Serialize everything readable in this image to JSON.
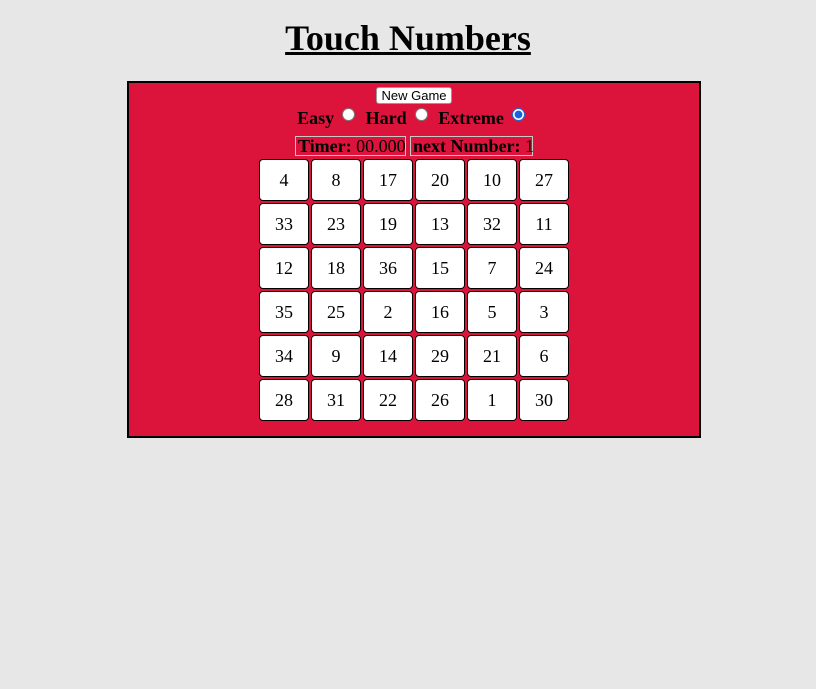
{
  "header": {
    "title": "Touch Numbers"
  },
  "controls": {
    "new_game_label": "New Game",
    "difficulties": [
      {
        "label": "Easy",
        "selected": false
      },
      {
        "label": "Hard",
        "selected": false
      },
      {
        "label": "Extreme",
        "selected": true
      }
    ]
  },
  "status": {
    "timer_label": "Timer:",
    "timer_value": "00.000",
    "next_label": "next Number:",
    "next_value": "1"
  },
  "grid": {
    "cells": [
      4,
      8,
      17,
      20,
      10,
      27,
      33,
      23,
      19,
      13,
      32,
      11,
      12,
      18,
      36,
      15,
      7,
      24,
      35,
      25,
      2,
      16,
      5,
      3,
      34,
      9,
      14,
      29,
      21,
      6,
      28,
      31,
      22,
      26,
      1,
      30
    ]
  },
  "colors": {
    "page_background": "#e7e7e7",
    "board_background": "#dc143c",
    "cell_background": "#ffffff"
  }
}
